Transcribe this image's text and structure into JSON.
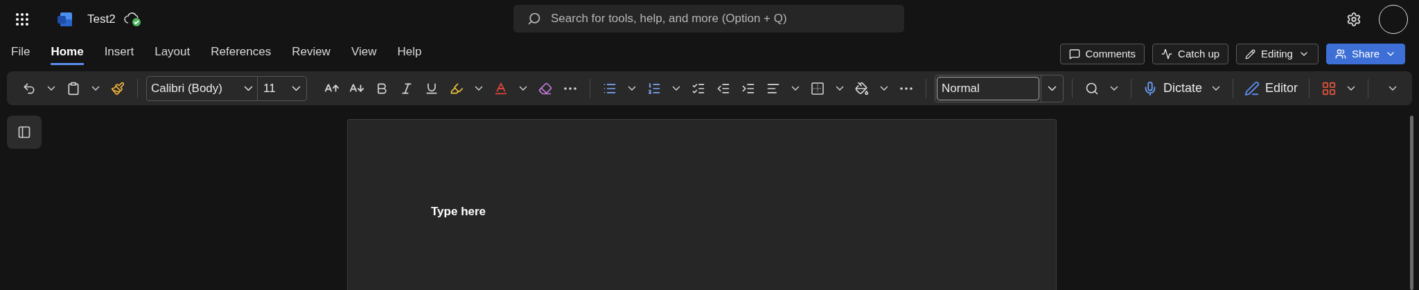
{
  "header": {
    "document_title": "Test2",
    "search": {
      "placeholder": "Search for tools, help, and more (Option + Q)"
    }
  },
  "tabs": [
    {
      "label": "File",
      "selected": false
    },
    {
      "label": "Home",
      "selected": true
    },
    {
      "label": "Insert",
      "selected": false
    },
    {
      "label": "Layout",
      "selected": false
    },
    {
      "label": "References",
      "selected": false
    },
    {
      "label": "Review",
      "selected": false
    },
    {
      "label": "View",
      "selected": false
    },
    {
      "label": "Help",
      "selected": false
    }
  ],
  "actions": [
    {
      "label": "Comments",
      "kind": "comments"
    },
    {
      "label": "Catch up",
      "kind": "catchup"
    },
    {
      "label": "Editing",
      "kind": "editing"
    },
    {
      "label": "Share",
      "kind": "share"
    }
  ],
  "toolbar": {
    "font": "Calibri (Body)",
    "size": "11",
    "style": "Normal",
    "dictate": "Dictate",
    "editor": "Editor"
  },
  "document": {
    "text": "Type here"
  }
}
